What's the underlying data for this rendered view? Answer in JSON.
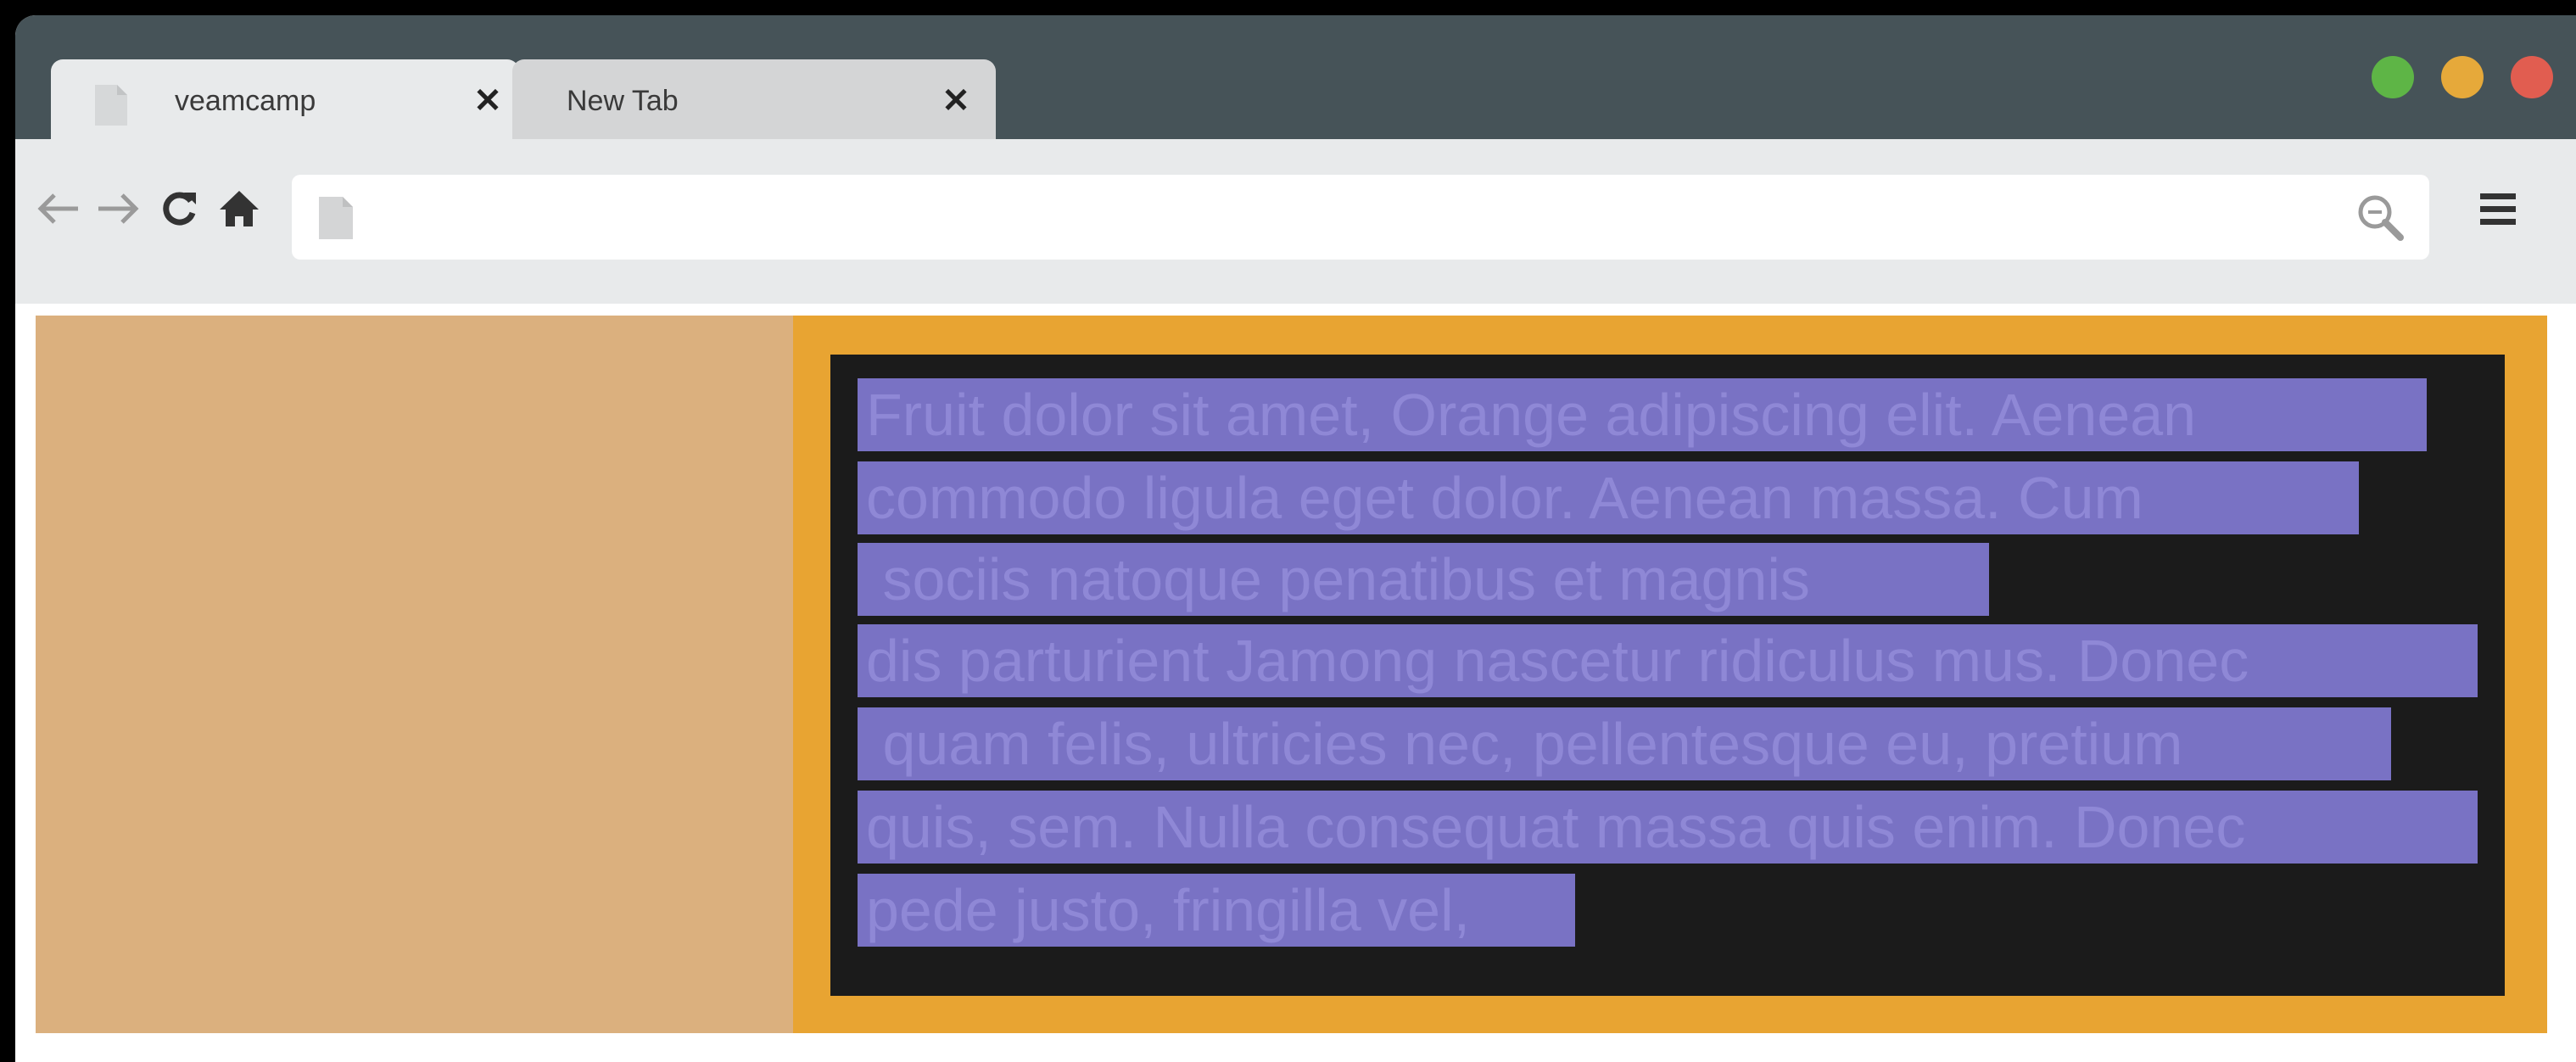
{
  "browser": {
    "tabs": [
      {
        "label": "veamcamp",
        "active": true,
        "close_glyph": "✕"
      },
      {
        "label": "New Tab",
        "active": false,
        "close_glyph": "✕"
      }
    ],
    "window_controls": [
      {
        "name": "maximize",
        "color": "#5eb546"
      },
      {
        "name": "minimize",
        "color": "#e6a93a"
      },
      {
        "name": "close",
        "color": "#e15d50"
      }
    ],
    "nav": {
      "back_icon": "arrow-left-icon",
      "forward_icon": "arrow-right-icon",
      "reload_icon": "reload-icon",
      "home_icon": "home-icon"
    },
    "address_bar": {
      "value": "",
      "placeholder": ""
    },
    "menu_icon": "hamburger-menu-icon"
  },
  "page": {
    "left_panel_color": "#dbb07e",
    "right_panel_color": "#e8a432",
    "dark_box_color": "#1b1b1b",
    "highlight_color": "#7972c4",
    "text_lines": [
      "Fruit dolor sit amet, Orange adipiscing elit. Aenean",
      "commodo ligula eget dolor. Aenean massa. Cum",
      " sociis natoque penatibus et magnis",
      "dis parturient Jamong nascetur ridiculus mus. Donec",
      " quam felis, ultricies nec, pellentesque eu, pretium",
      "quis, sem. Nulla consequat massa quis enim. Donec",
      "pede justo, fringilla vel,"
    ]
  }
}
